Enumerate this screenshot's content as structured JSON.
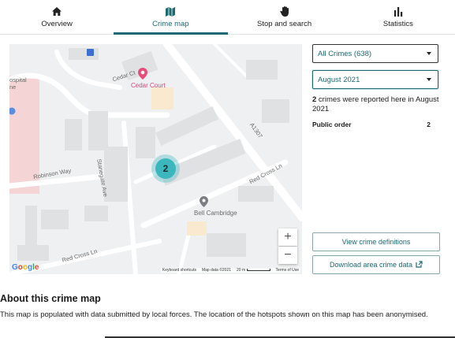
{
  "tabs": [
    {
      "label": "Overview",
      "icon": "home-icon"
    },
    {
      "label": "Crime map",
      "icon": "map-icon",
      "active": true
    },
    {
      "label": "Stop and search",
      "icon": "hand-icon"
    },
    {
      "label": "Statistics",
      "icon": "bar-chart-icon"
    }
  ],
  "map": {
    "labels": {
      "cedar_ct": "Cedar Ct",
      "cedar_court": "Cedar Court",
      "a1307": "A1307",
      "robinson_way": "Robinson Way",
      "stanegate_ave": "Stanegate Ave",
      "red_cross_ln_1": "Red Cross Ln",
      "red_cross_ln_2": "Red Cross Ln",
      "bell_cambridge": "Bell Cambridge",
      "hospital_1": "ospital",
      "hospital_2": "ne"
    },
    "cluster_count": "2",
    "zoom_in": "+",
    "zoom_out": "−",
    "google_logo": "Google",
    "attribution": {
      "shortcuts": "Keyboard shortcuts",
      "data": "Map data ©2021",
      "scale": "20 m",
      "terms": "Terms of Use"
    },
    "colors": {
      "cluster": "#3cb7bd",
      "background": "#eef0f1"
    }
  },
  "filters": {
    "crime_type": "All Crimes (638)",
    "month": "August 2021"
  },
  "summary": {
    "count": "2",
    "text": " crimes were reported here in August 2021"
  },
  "breakdown": [
    {
      "label": "Public order",
      "value": "2"
    }
  ],
  "buttons": {
    "definitions": "View crime definitions",
    "download": "Download area crime data"
  },
  "about": {
    "title": "About this crime map",
    "text": "This map is populated with data submitted by local forces. The location of the hotspots shown on this map has been anonymised."
  },
  "accent_color": "#1d6a73"
}
